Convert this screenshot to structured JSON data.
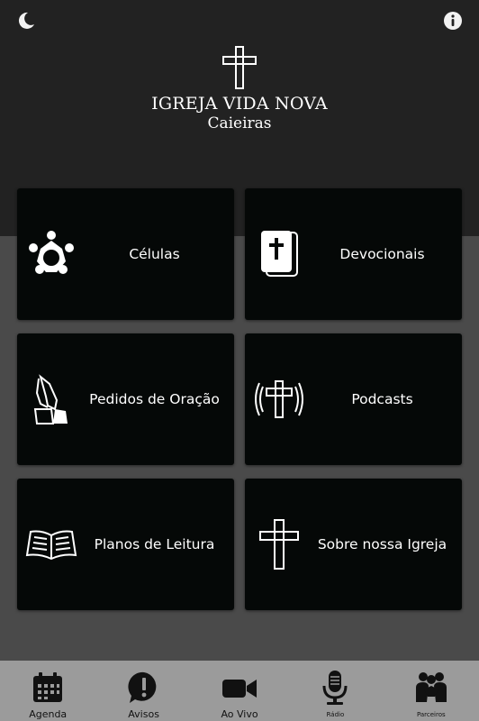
{
  "header": {
    "church_name": "IGREJA VIDA NOVA",
    "church_location": "Caieiras",
    "theme_icon": "moon-icon",
    "info_icon": "info-icon"
  },
  "menu": {
    "cards": [
      {
        "label": "Células",
        "icon": "group-icon"
      },
      {
        "label": "Devocionais",
        "icon": "bible-cross-icon"
      },
      {
        "label": "Pedidos de Oração",
        "icon": "praying-hands-icon"
      },
      {
        "label": "Podcasts",
        "icon": "broadcast-cross-icon"
      },
      {
        "label": "Planos de Leitura",
        "icon": "open-book-icon"
      },
      {
        "label": "Sobre nossa Igreja",
        "icon": "cross-icon"
      }
    ]
  },
  "bottom_nav": {
    "items": [
      {
        "label": "Agenda",
        "icon": "calendar-icon"
      },
      {
        "label": "Avisos",
        "icon": "alert-icon"
      },
      {
        "label": "Ao Vivo",
        "icon": "video-camera-icon"
      },
      {
        "label": "Rádio",
        "icon": "microphone-icon"
      },
      {
        "label": "Parceiros",
        "icon": "handshake-icon"
      }
    ]
  },
  "colors": {
    "header_bg": "#222222",
    "body_bg": "#4a4a4a",
    "card_bg": "#050807",
    "nav_bg": "#9b9b9b"
  }
}
